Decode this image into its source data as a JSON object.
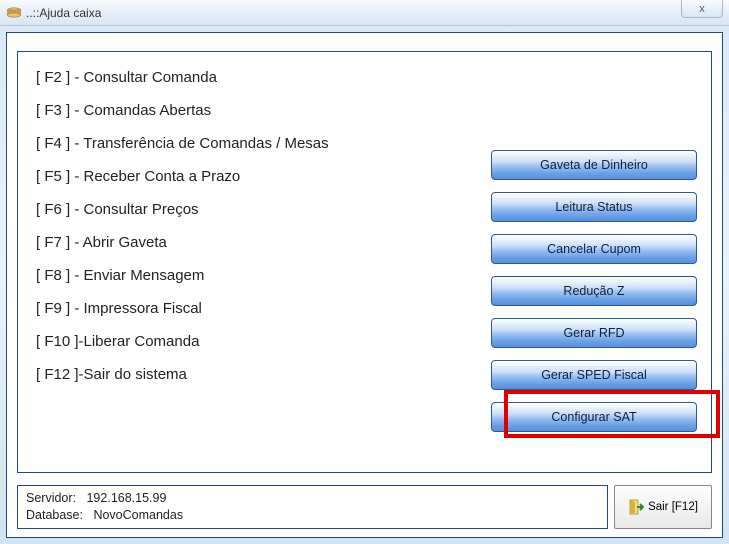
{
  "window": {
    "title": "..::Ajuda caixa",
    "close_label": "x"
  },
  "fkeys": [
    "[ F2 ] - Consultar Comanda",
    "[ F3 ] - Comandas Abertas",
    "[ F4 ] - Transferência de Comandas / Mesas",
    "[ F5 ] - Receber Conta a Prazo",
    "[ F6 ] - Consultar Preços",
    "[ F7 ] - Abrir Gaveta",
    "[ F8 ] - Enviar Mensagem",
    "[ F9 ] - Impressora Fiscal",
    "[ F10 ]-Liberar Comanda",
    "[ F12 ]-Sair do sistema"
  ],
  "buttons": {
    "gaveta": "Gaveta de Dinheiro",
    "leitura": "Leitura Status",
    "cancelar": "Cancelar Cupom",
    "reducao": "Redução Z",
    "rfd": "Gerar RFD",
    "sped": "Gerar SPED Fiscal",
    "sat": "Configurar SAT"
  },
  "status": {
    "servidor_label": "Servidor:",
    "servidor_value": "192.168.15.99",
    "database_label": "Database:",
    "database_value": "NovoComandas"
  },
  "exit": {
    "label": "Sair [F12]"
  }
}
